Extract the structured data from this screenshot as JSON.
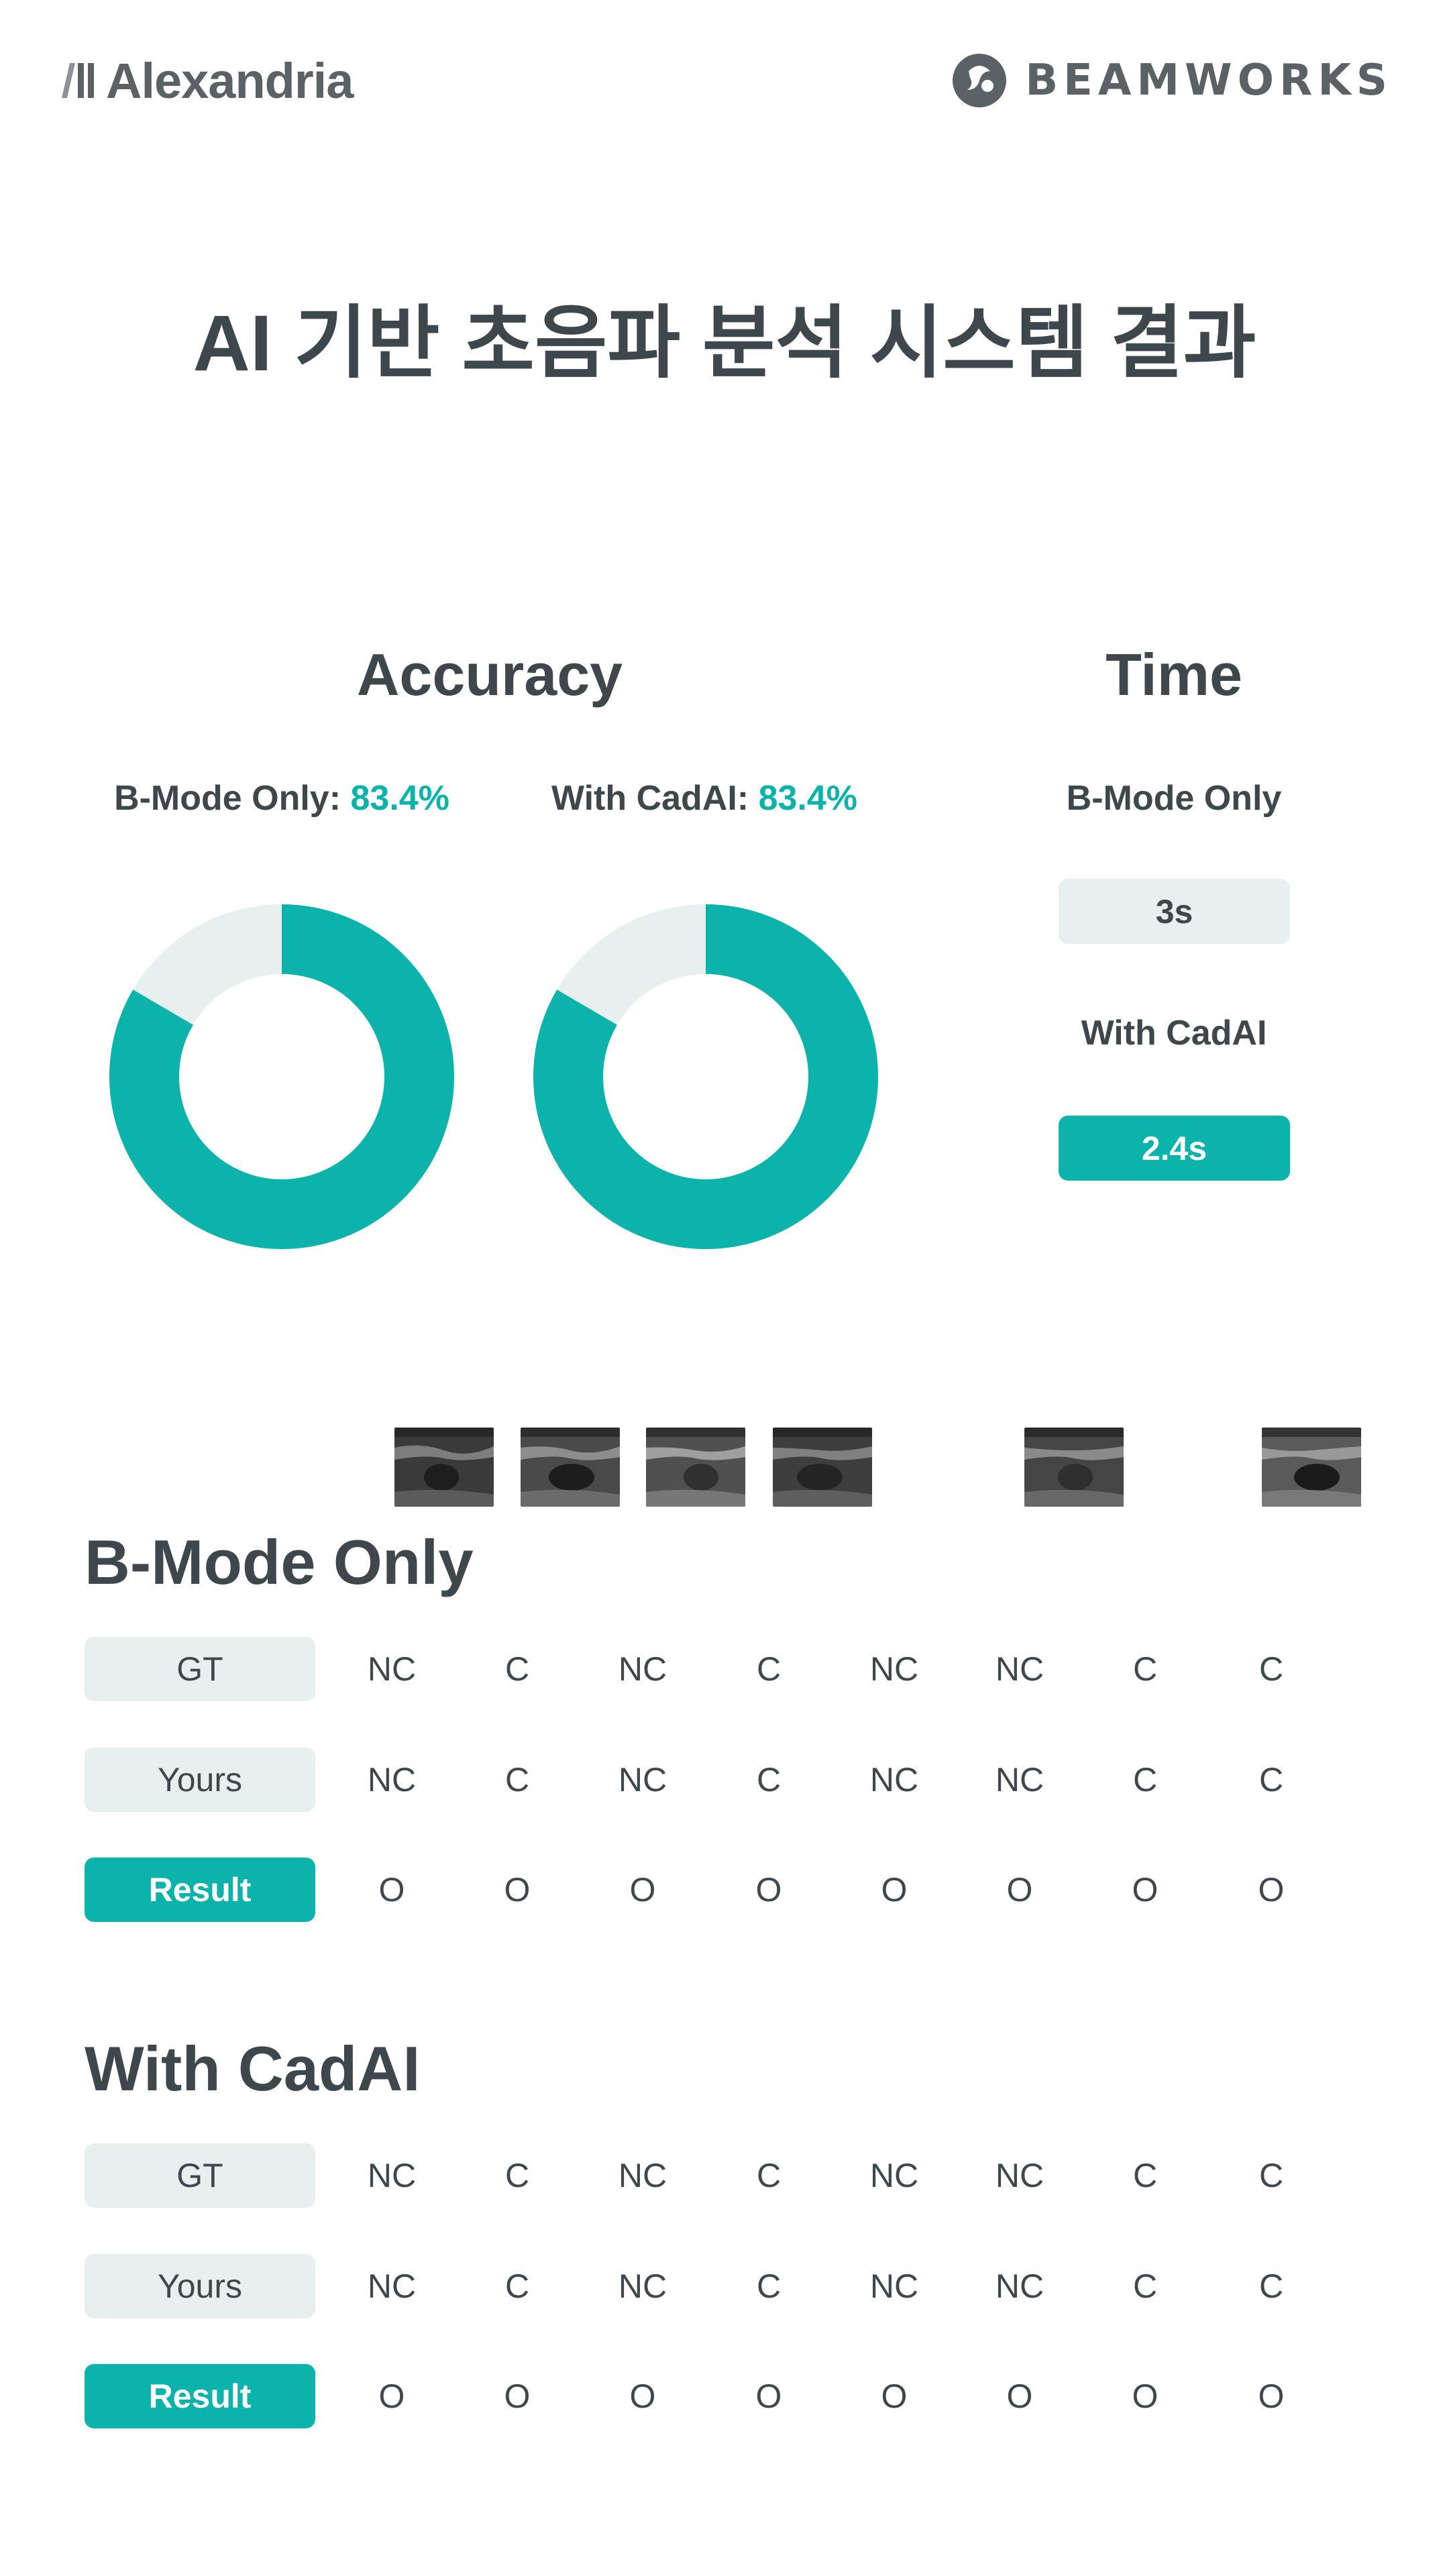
{
  "header": {
    "left_brand": "Alexandria",
    "right_brand": "Beamworks"
  },
  "page_title": "AI 기반 초음파 분석 시스템 결과",
  "accuracy": {
    "heading": "Accuracy",
    "items": [
      {
        "label": "B-Mode Only: ",
        "value": "83.4%",
        "fraction": 0.834
      },
      {
        "label": "With CadAI: ",
        "value": "83.4%",
        "fraction": 0.834
      }
    ]
  },
  "time": {
    "heading": "Time",
    "items": [
      {
        "label": "B-Mode Only",
        "value": "3s"
      },
      {
        "label": "With CadAI",
        "value": "2.4s"
      }
    ]
  },
  "thumbnails": [
    "scan-image",
    "scan-image",
    "scan-image",
    "scan-image",
    "scan-image",
    "scan-image"
  ],
  "tables": [
    {
      "title": "B-Mode Only",
      "rows": [
        {
          "label": "GT",
          "cells": [
            "NC",
            "C",
            "NC",
            "C",
            "NC",
            "NC",
            "C",
            "C"
          ]
        },
        {
          "label": "Yours",
          "cells": [
            "NC",
            "C",
            "NC",
            "C",
            "NC",
            "NC",
            "C",
            "C"
          ]
        },
        {
          "label": "Result",
          "cells": [
            "O",
            "O",
            "O",
            "O",
            "O",
            "O",
            "O",
            "O"
          ]
        }
      ]
    },
    {
      "title": "With CadAI",
      "rows": [
        {
          "label": "GT",
          "cells": [
            "NC",
            "C",
            "NC",
            "C",
            "NC",
            "NC",
            "C",
            "C"
          ]
        },
        {
          "label": "Yours",
          "cells": [
            "NC",
            "C",
            "NC",
            "C",
            "NC",
            "NC",
            "C",
            "C"
          ]
        },
        {
          "label": "Result",
          "cells": [
            "O",
            "O",
            "O",
            "O",
            "O",
            "O",
            "O",
            "O"
          ]
        }
      ]
    }
  ],
  "colors": {
    "accent": "#0cb3ab",
    "track": "#e8efef",
    "text": "#3e474b"
  }
}
